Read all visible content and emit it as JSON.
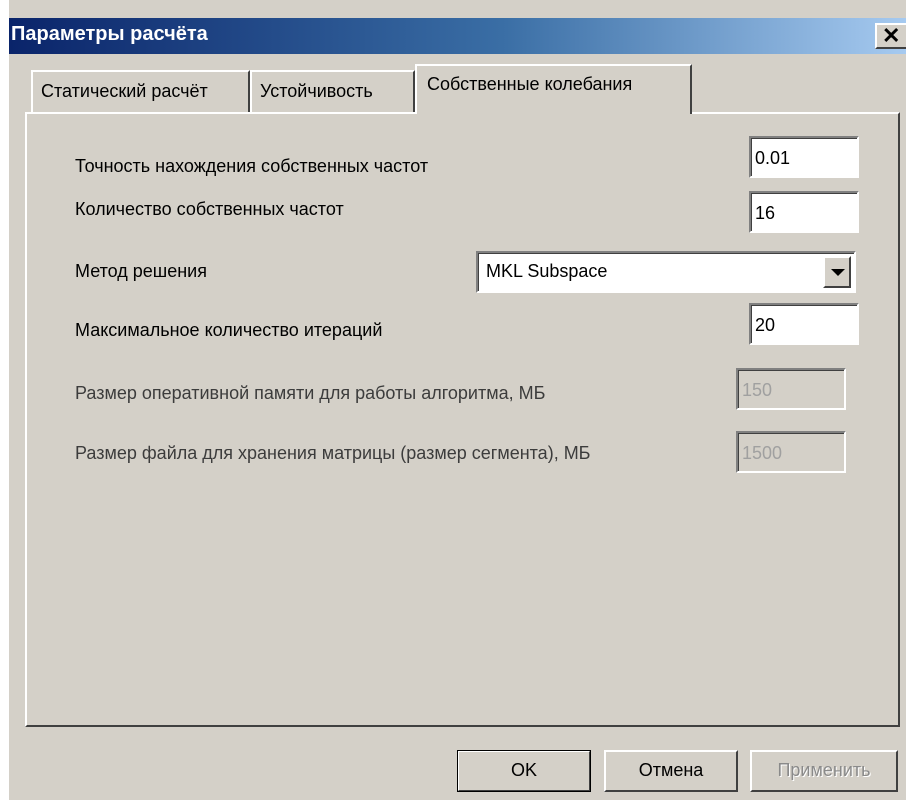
{
  "window": {
    "title": "Параметры расчёта",
    "close_label": "✕"
  },
  "tabs": [
    {
      "label": "Статический расчёт",
      "active": false
    },
    {
      "label": "Устойчивость",
      "active": false
    },
    {
      "label": "Собственные колебания",
      "active": true
    }
  ],
  "form": {
    "precision_label": "Точность нахождения собственных частот",
    "precision_value": "0.01",
    "count_label": "Количество собственных частот",
    "count_value": "16",
    "method_label": "Метод решения",
    "method_value": "MKL Subspace",
    "iterations_label": "Максимальное количество итераций",
    "iterations_value": "20",
    "memory_label": "Размер оперативной памяти для работы алгоритма, МБ",
    "memory_value": "150",
    "file_label": "Размер файла для хранения матрицы (размер сегмента), МБ",
    "file_value": "1500"
  },
  "buttons": {
    "ok": "OK",
    "cancel": "Отмена",
    "apply": "Применить"
  }
}
